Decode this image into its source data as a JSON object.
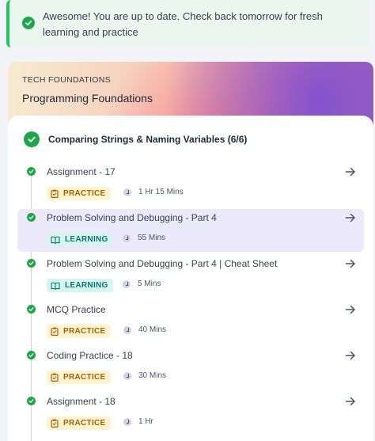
{
  "banner": {
    "message": "Awesome! You are up to date. Check back tomorrow for fresh learning and practice"
  },
  "course": {
    "overline": "TECH FOUNDATIONS",
    "title": "Programming Foundations"
  },
  "section": {
    "title": "Comparing Strings & Naming Variables (6/6)"
  },
  "items": [
    {
      "title": "Assignment - 17",
      "type": "PRACTICE",
      "duration": "1 Hr 15 Mins",
      "completed": true,
      "active": false
    },
    {
      "title": "Problem Solving and Debugging - Part 4",
      "type": "LEARNING",
      "duration": "55 Mins",
      "completed": true,
      "active": true
    },
    {
      "title": "Problem Solving and Debugging - Part 4 | Cheat Sheet",
      "type": "LEARNING",
      "duration": "5 Mins",
      "completed": true,
      "active": false
    },
    {
      "title": "MCQ Practice",
      "type": "PRACTICE",
      "duration": "40 Mins",
      "completed": true,
      "active": false
    },
    {
      "title": "Coding Practice - 18",
      "type": "PRACTICE",
      "duration": "30 Mins",
      "completed": true,
      "active": false
    },
    {
      "title": "Assignment - 18",
      "type": "PRACTICE",
      "duration": "1 Hr",
      "completed": true,
      "active": false
    }
  ],
  "colors": {
    "success": "#1fa54a",
    "practice_bg": "#fdf3cf",
    "practice_fg": "#a16207",
    "learning_bg": "#d6f5ee",
    "learning_fg": "#0f766e",
    "active_bg": "#ece9fb"
  },
  "icons": {
    "banner": "check-circle-icon",
    "practice": "clipboard-check-icon",
    "learning": "open-book-icon",
    "duration": "clock-icon",
    "open": "arrow-right-icon"
  }
}
